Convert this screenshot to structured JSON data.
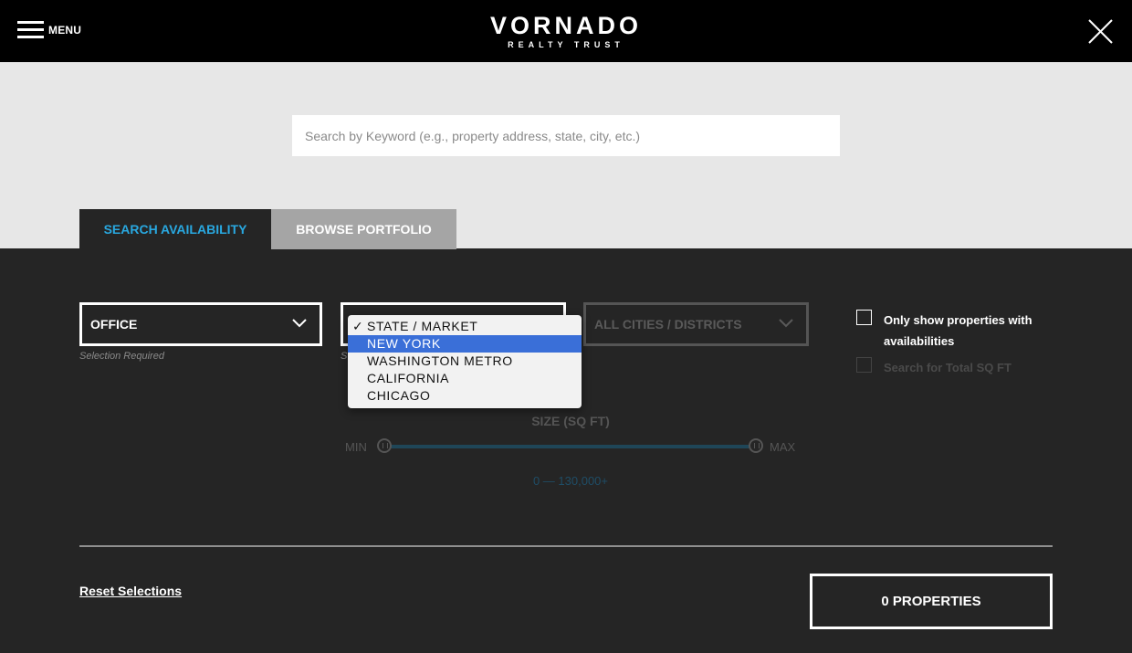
{
  "header": {
    "menu_label": "MENU",
    "logo_main": "VORNADO",
    "logo_sub": "REALTY TRUST"
  },
  "search": {
    "placeholder": "Search by Keyword (e.g., property address, state, city, etc.)"
  },
  "tabs": [
    {
      "label": "SEARCH AVAILABILITY",
      "active": true
    },
    {
      "label": "BROWSE PORTFOLIO",
      "active": false
    }
  ],
  "filters": {
    "property_type": {
      "value": "OFFICE",
      "helper": "Selection Required"
    },
    "state_market": {
      "helper": "S",
      "options": [
        {
          "label": "STATE / MARKET",
          "checked": true
        },
        {
          "label": "NEW YORK",
          "highlighted": true
        },
        {
          "label": "WASHINGTON METRO"
        },
        {
          "label": "CALIFORNIA"
        },
        {
          "label": "CHICAGO"
        }
      ]
    },
    "cities": {
      "value": "ALL CITIES / DISTRICTS"
    },
    "only_available_label": "Only show properties with availabilities",
    "total_sqft_label": "Search for Total SQ FT"
  },
  "size": {
    "title": "SIZE (SQ FT)",
    "min_label": "MIN",
    "max_label": "MAX",
    "range_text": "0 — 130,000+"
  },
  "footer": {
    "reset_label": "Reset Selections",
    "results_label": "0 PROPERTIES"
  },
  "colors": {
    "accent": "#29a8e0",
    "highlight": "#3a6fd8",
    "background": "#252525"
  }
}
